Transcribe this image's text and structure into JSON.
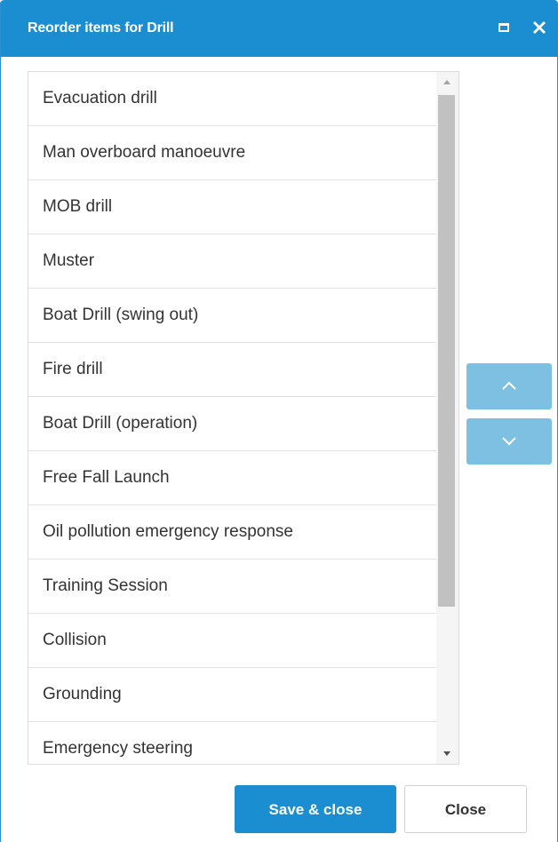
{
  "dialog": {
    "title": "Reorder items for Drill",
    "maximize_icon": "maximize-icon",
    "close_icon": "close-icon"
  },
  "items": [
    "Evacuation drill",
    "Man overboard manoeuvre",
    "MOB drill",
    "Muster",
    "Boat Drill (swing out)",
    "Fire drill",
    "Boat Drill (operation)",
    "Free Fall Launch",
    "Oil pollution emergency response",
    "Training Session",
    "Collision",
    "Grounding",
    "Emergency steering"
  ],
  "reorder": {
    "up_icon": "chevron-up-icon",
    "down_icon": "chevron-down-icon"
  },
  "footer": {
    "save_label": "Save & close",
    "close_label": "Close"
  },
  "colors": {
    "accent": "#1a8ed0",
    "reorder_button": "#7ec0e2"
  }
}
